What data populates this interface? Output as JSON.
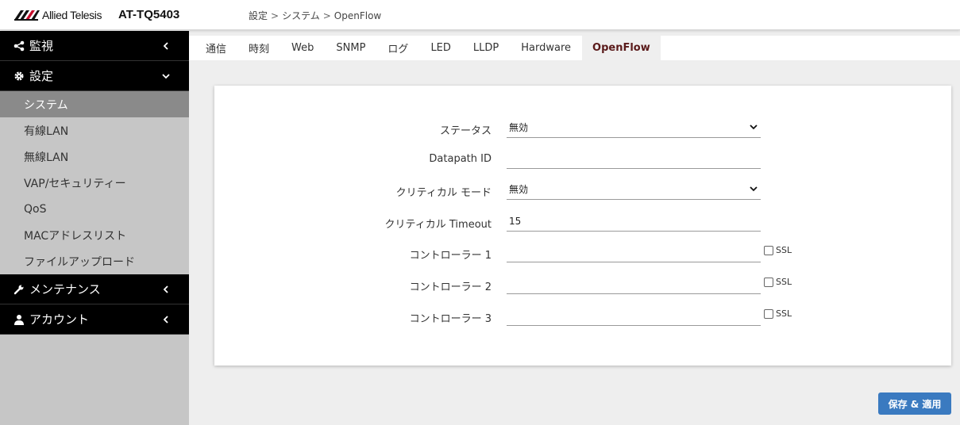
{
  "header": {
    "brand": "Allied Telesis",
    "model": "AT-TQ5403",
    "breadcrumb": [
      "設定",
      "システム",
      "OpenFlow"
    ],
    "breadcrumb_sep": ">"
  },
  "sidebar": {
    "sections": [
      {
        "label": "監視",
        "icon": "share-icon",
        "state": "collapsed"
      },
      {
        "label": "設定",
        "icon": "gear-icon",
        "state": "expanded"
      },
      {
        "label": "メンテナンス",
        "icon": "wrench-icon",
        "state": "collapsed"
      },
      {
        "label": "アカウント",
        "icon": "user-icon",
        "state": "collapsed"
      }
    ],
    "items": [
      {
        "label": "システム",
        "active": true
      },
      {
        "label": "有線LAN"
      },
      {
        "label": "無線LAN"
      },
      {
        "label": "VAP/セキュリティー"
      },
      {
        "label": "QoS"
      },
      {
        "label": "MACアドレスリスト"
      },
      {
        "label": "ファイルアップロード"
      }
    ]
  },
  "tabs": [
    "通信",
    "時刻",
    "Web",
    "SNMP",
    "ログ",
    "LED",
    "LLDP",
    "Hardware",
    "OpenFlow"
  ],
  "active_tab": "OpenFlow",
  "form": {
    "status": {
      "label": "ステータス",
      "value": "無効"
    },
    "datapath_id": {
      "label": "Datapath ID",
      "value": ""
    },
    "critical_mode": {
      "label": "クリティカル モード",
      "value": "無効"
    },
    "critical_timeout": {
      "label": "クリティカル Timeout",
      "value": "15"
    },
    "controllers": [
      {
        "label": "コントローラー 1",
        "value": "",
        "ssl_label": "SSL",
        "ssl_checked": false
      },
      {
        "label": "コントローラー 2",
        "value": "",
        "ssl_label": "SSL",
        "ssl_checked": false
      },
      {
        "label": "コントローラー 3",
        "value": "",
        "ssl_label": "SSL",
        "ssl_checked": false
      }
    ]
  },
  "save_button": "保存 & 適用",
  "colors": {
    "nav_bg": "#000000",
    "sidebar_bg": "#c6c6c6",
    "active_item": "#8a8a8a",
    "active_tab_text": "#5a1a1a",
    "primary_button": "#3a7ac0"
  }
}
